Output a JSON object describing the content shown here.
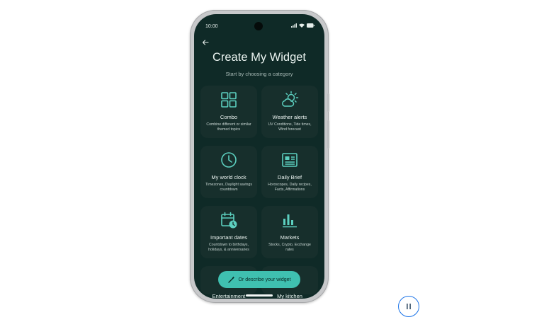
{
  "status_bar": {
    "time": "10:00",
    "icons": [
      "signal-icon",
      "wifi-icon",
      "battery-icon"
    ]
  },
  "header": {
    "back_icon": "back-arrow-icon",
    "title": "Create My Widget",
    "subtitle": "Start by choosing a category"
  },
  "categories": [
    {
      "label": "Combo",
      "description": "Combine different or similar themed topics",
      "icon": "grid-icon"
    },
    {
      "label": "Weather alerts",
      "description": "UV Conditions, Tide times, Wind forecast",
      "icon": "weather-icon"
    },
    {
      "label": "My world clock",
      "description": "Timezones, Daylight savings countdown",
      "icon": "clock-icon"
    },
    {
      "label": "Daily Brief",
      "description": "Horoscopes, Daily recipes, Facts, Affirmations",
      "icon": "newspaper-icon"
    },
    {
      "label": "Important dates",
      "description": "Countdown to birthdays, holidays, & anniversaries",
      "icon": "calendar-clock-icon"
    },
    {
      "label": "Markets",
      "description": "Stocks, Crypto, Exchange rates",
      "icon": "bar-chart-icon"
    },
    {
      "label": "Entertainment",
      "description": "",
      "icon": ""
    },
    {
      "label": "My kitchen",
      "description": "",
      "icon": ""
    }
  ],
  "fab": {
    "label": "Or describe your widget",
    "icon": "magic-wand-icon"
  },
  "player": {
    "pause_icon": "pause-icon"
  },
  "colors": {
    "screen_bg": "#0f2a27",
    "card_bg": "#172f2c",
    "accent": "#3fc0b0",
    "icon_color": "#5ccfbf"
  }
}
